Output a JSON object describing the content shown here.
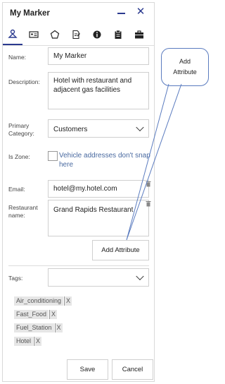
{
  "header": {
    "title": "My Marker"
  },
  "tabs": [
    {
      "icon": "person-marker-icon"
    },
    {
      "icon": "id-card-icon"
    },
    {
      "icon": "pentagon-icon"
    },
    {
      "icon": "edit-note-icon"
    },
    {
      "icon": "info-icon"
    },
    {
      "icon": "clipboard-icon"
    },
    {
      "icon": "briefcase-icon"
    }
  ],
  "form": {
    "name_label": "Name:",
    "name_value": "My Marker",
    "description_label": "Description:",
    "description_value": "Hotel with restaurant and adjacent gas facilities",
    "category_label": "Primary Category:",
    "category_value": "Customers",
    "zone_label": "Is Zone:",
    "zone_text": "Vehicle addresses don't snap here",
    "email_label": "Email:",
    "email_value": "hotel@my.hotel.com",
    "restaurant_label": "Restaurant name:",
    "restaurant_value": "Grand Rapids Restaurant",
    "add_attribute_label": "Add Attribute",
    "tags_label": "Tags:",
    "tags": [
      "Air_conditioning",
      "Fast_Food",
      "Fuel_Station",
      "Hotel"
    ],
    "tag_remove": "X"
  },
  "footer": {
    "save_label": "Save",
    "cancel_label": "Cancel"
  },
  "callout": {
    "text": "Add Attribute"
  },
  "colors": {
    "accent": "#2b3a8f",
    "callout_border": "#5a7bbf"
  }
}
